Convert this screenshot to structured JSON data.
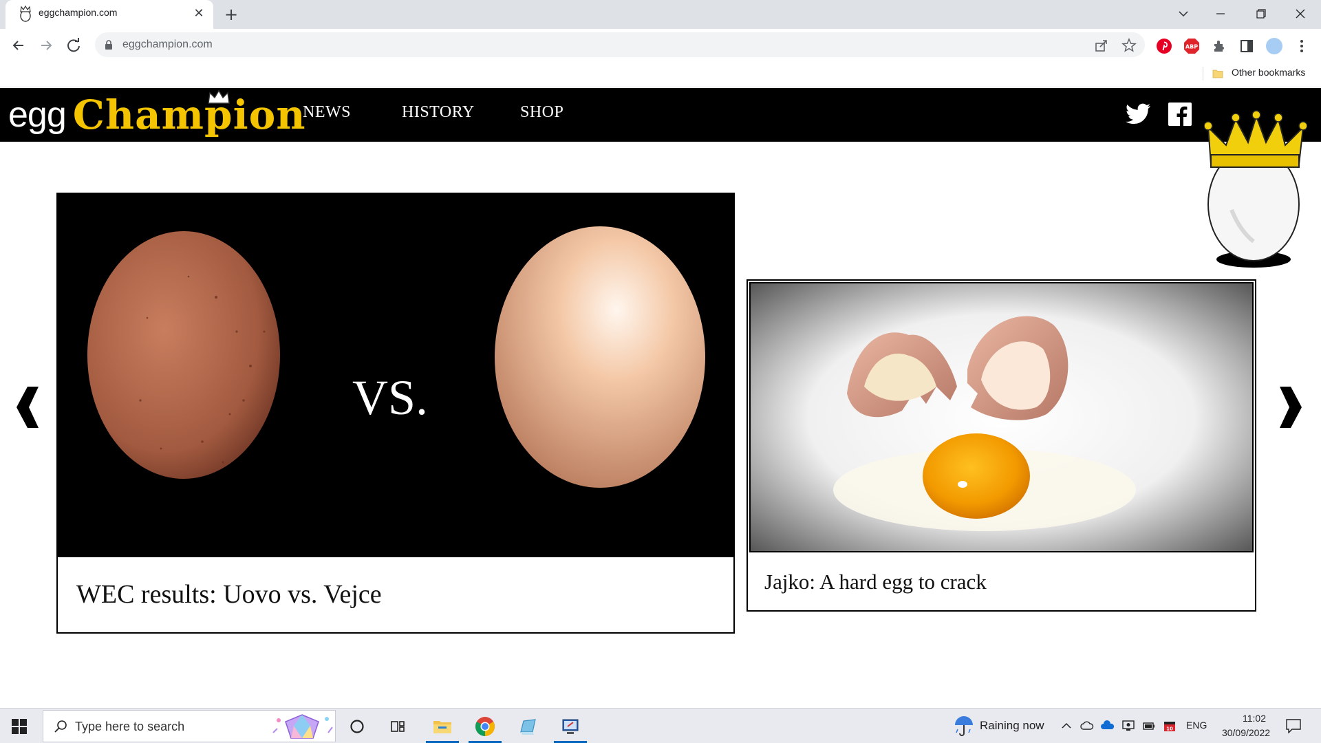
{
  "browser": {
    "tab_title": "eggchampion.com",
    "url": "eggchampion.com",
    "new_tab_symbol": "+",
    "close_symbol": "✕",
    "bookmarks": {
      "other_label": "Other bookmarks"
    }
  },
  "site": {
    "logo": {
      "part1": "egg",
      "part2": "Champion"
    },
    "nav": [
      {
        "label": "NEWS"
      },
      {
        "label": "HISTORY"
      },
      {
        "label": "SHOP"
      }
    ],
    "social": [
      "twitter-icon",
      "facebook-icon"
    ],
    "colors": {
      "brand_yellow": "#f4c400",
      "header_bg": "#000000"
    }
  },
  "carousel": {
    "main": {
      "image_text": "VS.",
      "caption": "WEC  results: Uovo vs. Vejce"
    },
    "side": {
      "caption": "Jajko: A hard egg to crack"
    }
  },
  "taskbar": {
    "search_placeholder": "Type here to search",
    "weather": "Raining now",
    "language": "ENG",
    "time": "11:02",
    "date": "30/09/2022"
  }
}
